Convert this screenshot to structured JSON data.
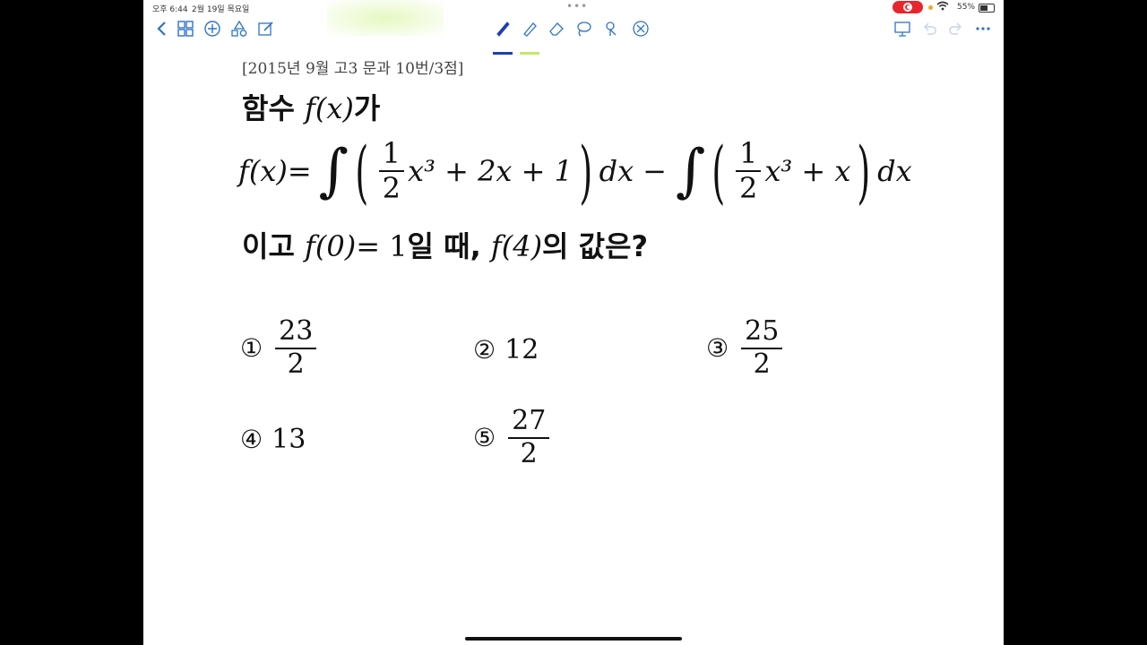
{
  "status": {
    "time": "오후 6:44",
    "date": "2월 19일 목요일",
    "battery": "55%",
    "battery_level": 0.55
  },
  "toolbar": {
    "left_icons": [
      "chevron-left-icon",
      "grid-icon",
      "add-circle-icon",
      "shapes-icon",
      "edit-icon"
    ],
    "center_icons": [
      "pen-icon",
      "highlighter-icon",
      "eraser-icon",
      "lasso-icon",
      "pointer-icon",
      "close-circle-icon"
    ],
    "right_icons": [
      "presentation-icon",
      "undo-icon",
      "redo-icon",
      "more-icon"
    ],
    "pen_color": "#1f3fb0",
    "highlighter_color": "#c6e86a",
    "accent": "#2f73c9"
  },
  "problem": {
    "source": "[2015년 9월 고3 문과 10번/3점]",
    "line1_prefix": "함수 ",
    "line1_suffix": "가",
    "fx": "f(x)",
    "frac_num": "1",
    "frac_den": "2",
    "part1_rest": "x³ + 2x + 1",
    "part2_rest": "x³ + x",
    "dx": "dx",
    "minus": "−",
    "equals": "=",
    "line3_prefix": "이고 ",
    "f0": "f(0)",
    "eq1": "= 1",
    "line3_mid": "일 때, ",
    "f4": "f(4)",
    "line3_suffix": "의 값은?"
  },
  "choices": [
    {
      "mark": "①",
      "num": "23",
      "den": "2"
    },
    {
      "mark": "②",
      "value": "12"
    },
    {
      "mark": "③",
      "num": "25",
      "den": "2"
    },
    {
      "mark": "④",
      "value": "13"
    },
    {
      "mark": "⑤",
      "num": "27",
      "den": "2"
    }
  ]
}
